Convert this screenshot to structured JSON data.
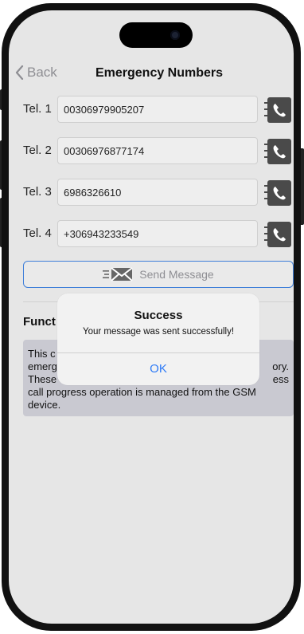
{
  "nav": {
    "back_label": "Back",
    "title": "Emergency Numbers"
  },
  "phones": [
    {
      "label": "Tel. 1",
      "value": "00306979905207"
    },
    {
      "label": "Tel. 2",
      "value": "00306976877174"
    },
    {
      "label": "Tel. 3",
      "value": "6986326610"
    },
    {
      "label": "Tel. 4",
      "value": "+306943233549"
    }
  ],
  "send_button_label": "Send Message",
  "functions": {
    "title_visible": "Funct",
    "lines_visible": [
      "This c",
      "emerg",
      "These",
      "call progress operation is managed from the GSM",
      "device."
    ],
    "line_fragments_right": [
      "",
      "ory.",
      "ess"
    ]
  },
  "alert": {
    "title": "Success",
    "message": "Your message was sent successfully!",
    "ok_label": "OK"
  },
  "colors": {
    "accent": "#2f7bf6",
    "button_border": "#3f7fd9",
    "screen_bg": "#e6e6e6",
    "call_icon_bg": "#4a4a4a"
  }
}
